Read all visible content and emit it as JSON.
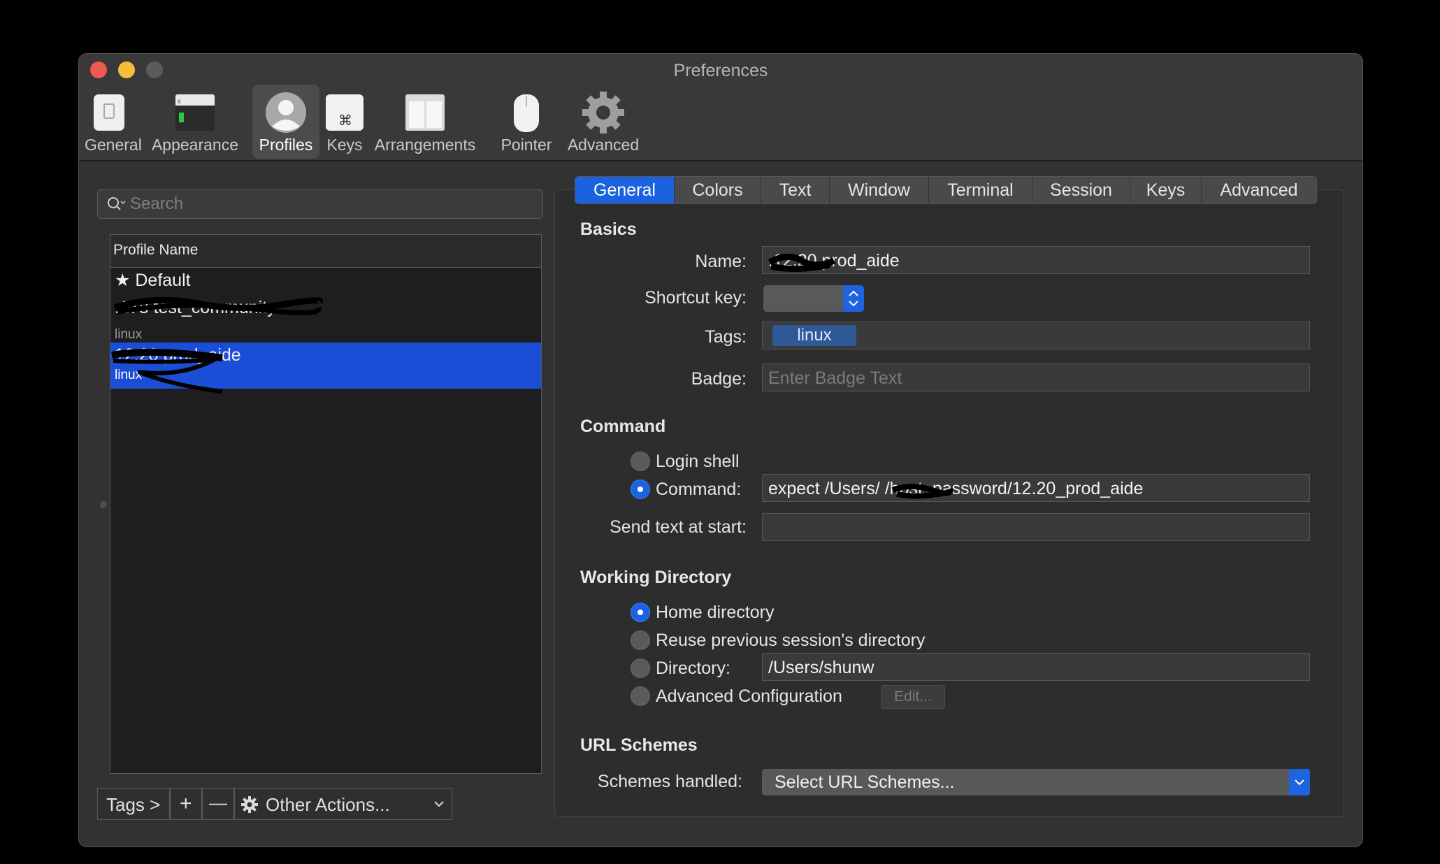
{
  "window": {
    "title": "Preferences"
  },
  "toolbar": {
    "items": [
      {
        "label": "General",
        "icon": "general-icon"
      },
      {
        "label": "Appearance",
        "icon": "appearance-icon"
      },
      {
        "label": "Profiles",
        "icon": "profiles-icon",
        "active": true
      },
      {
        "label": "Keys",
        "icon": "keys-icon"
      },
      {
        "label": "Arrangements",
        "icon": "arrangements-icon"
      },
      {
        "label": "Pointer",
        "icon": "pointer-icon"
      },
      {
        "label": "Advanced",
        "icon": "advanced-gear-icon"
      }
    ]
  },
  "search": {
    "placeholder": "Search"
  },
  "profile_list": {
    "header": "Profile Name",
    "rows": [
      {
        "name": "Default",
        "tag": ""
      },
      {
        "name": ".178 test_community",
        "tag": "linux"
      },
      {
        "name": "12.20 prod_aide",
        "tag": "linux",
        "selected": true
      }
    ]
  },
  "bottom_bar": {
    "tags_button": "Tags >",
    "add": "+",
    "remove": "—",
    "other_actions": "Other Actions..."
  },
  "tabs": [
    "General",
    "Colors",
    "Text",
    "Window",
    "Terminal",
    "Session",
    "Keys",
    "Advanced"
  ],
  "basics": {
    "heading": "Basics",
    "name_label": "Name:",
    "name_value": ".12.20 prod_aide",
    "shortcut_label": "Shortcut key:",
    "tags_label": "Tags:",
    "tag_value": "linux",
    "badge_label": "Badge:",
    "badge_placeholder": "Enter Badge Text"
  },
  "command": {
    "heading": "Command",
    "login_shell": "Login shell",
    "command_label": "Command:",
    "command_value": "expect /Users/      /host_password/12.20_prod_aide",
    "send_text_label": "Send text at start:"
  },
  "working_directory": {
    "heading": "Working Directory",
    "home": "Home directory",
    "reuse": "Reuse previous session's directory",
    "directory_label": "Directory:",
    "directory_value": "/Users/shunw",
    "advanced": "Advanced Configuration",
    "edit": "Edit..."
  },
  "url_schemes": {
    "heading": "URL Schemes",
    "label": "Schemes handled:",
    "select_value": "Select URL Schemes..."
  },
  "colors": {
    "accent": "#1a62df",
    "selection": "#1b4ed6",
    "window_bg": "#323232"
  }
}
